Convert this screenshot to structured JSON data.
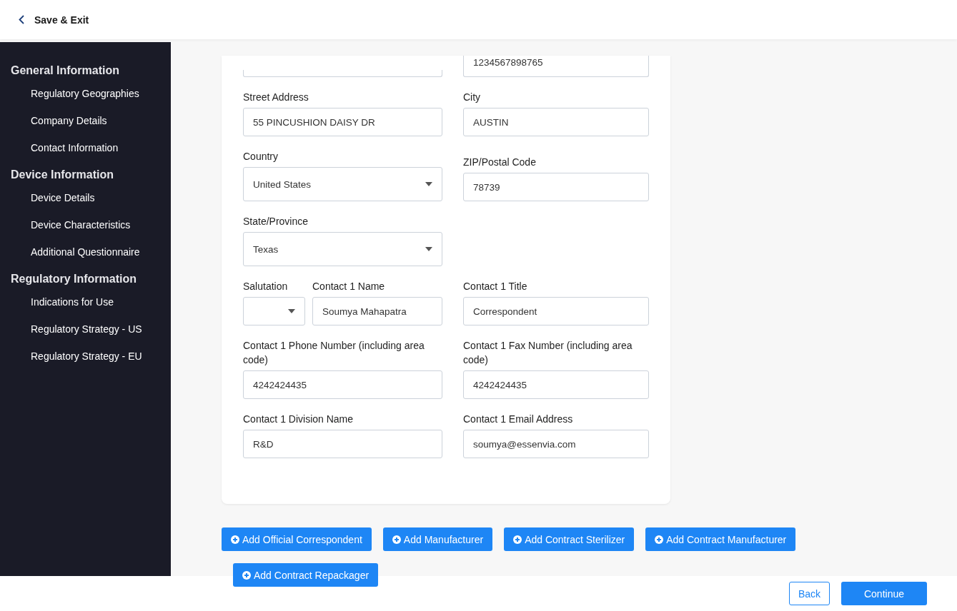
{
  "header": {
    "back_label": "Save & Exit"
  },
  "sidebar": {
    "sections": [
      {
        "title": "General Information",
        "items": [
          {
            "label": "Regulatory Geographies"
          },
          {
            "label": "Company Details"
          },
          {
            "label": "Contact Information"
          }
        ]
      },
      {
        "title": "Device Information",
        "items": [
          {
            "label": "Device Details"
          },
          {
            "label": "Device Characteristics"
          },
          {
            "label": "Additional Questionnaire"
          }
        ]
      },
      {
        "title": "Regulatory Information",
        "items": [
          {
            "label": "Indications for Use"
          },
          {
            "label": "Regulatory Strategy - US"
          },
          {
            "label": "Regulatory Strategy - EU"
          }
        ]
      }
    ]
  },
  "form": {
    "rows": [
      {
        "cells": [
          [
            {
              "kind": "text"
            }
          ],
          [
            {
              "kind": "text",
              "value": "1234567898765"
            }
          ]
        ]
      },
      {
        "cells": [
          [
            {
              "kind": "text",
              "label": "Street Address",
              "value": "55 PINCUSHION DAISY DR"
            }
          ],
          [
            {
              "kind": "text",
              "label": "City",
              "value": "AUSTIN"
            }
          ]
        ]
      },
      {
        "cells": [
          [
            {
              "kind": "select",
              "label": "Country",
              "value": "United States"
            }
          ],
          [
            {
              "kind": "text",
              "label": "ZIP/Postal Code",
              "value": "78739"
            }
          ]
        ]
      },
      {
        "cells": [
          [
            {
              "kind": "select",
              "label": "State/Province",
              "value": "Texas"
            }
          ],
          []
        ]
      },
      {
        "cells": [
          [
            {
              "kind": "select",
              "label": "Salutation"
            },
            {
              "kind": "text",
              "label": "Contact 1 Name",
              "value": "Soumya Mahapatra"
            }
          ],
          [
            {
              "kind": "text",
              "label": "Contact 1 Title",
              "value": "Correspondent"
            }
          ]
        ]
      },
      {
        "cells": [
          [
            {
              "kind": "text",
              "label": "Contact 1 Phone Number (including area code)",
              "value": "4242424435"
            }
          ],
          [
            {
              "kind": "text",
              "label": "Contact 1 Fax Number (including area code)",
              "value": "4242424435"
            }
          ]
        ]
      },
      {
        "cells": [
          [
            {
              "kind": "text",
              "label": "Contact 1 Division Name",
              "value": "R&D"
            }
          ],
          [
            {
              "kind": "text",
              "label": "Contact 1 Email Address",
              "value": "soumya@essenvia.com"
            }
          ]
        ]
      }
    ]
  },
  "add_buttons": [
    "Add Official Correspondent",
    "Add Manufacturer",
    "Add Contract Sterilizer",
    "Add Contract Manufacturer",
    "Add Contract Repackager"
  ],
  "footer": {
    "back": "Back",
    "continue": "Continue"
  }
}
